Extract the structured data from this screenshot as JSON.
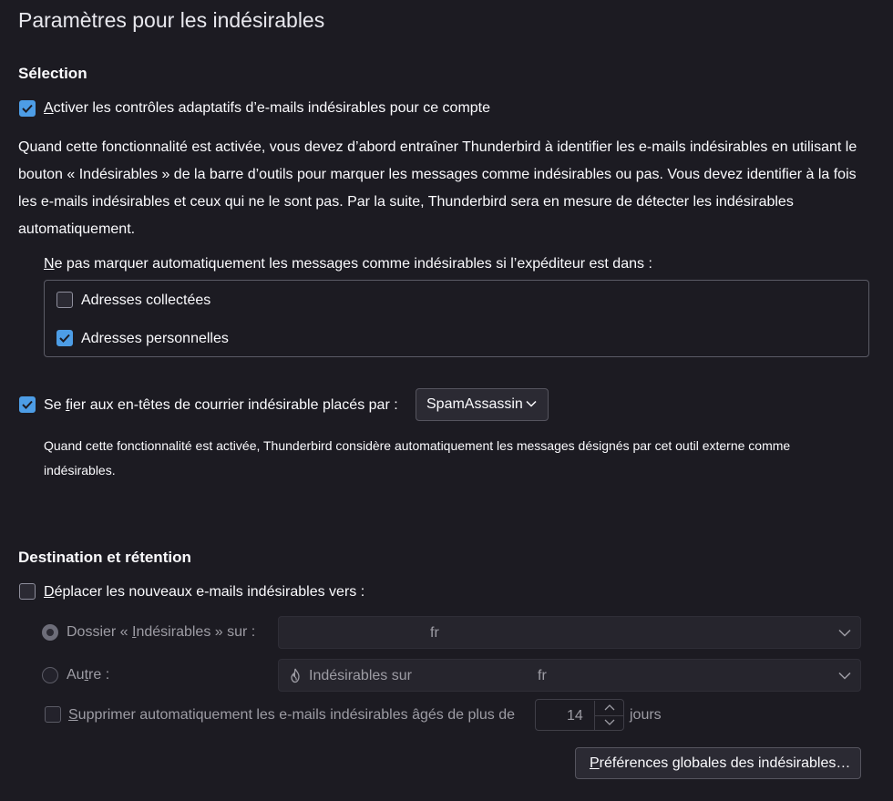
{
  "page": {
    "title": "Paramètres pour les indésirables"
  },
  "selection": {
    "heading": "Sélection",
    "adaptive": {
      "checked": true,
      "label_first": "A",
      "label_rest": "ctiver les contrôles adaptatifs d’e-mails indésirables pour ce compte"
    },
    "description": "Quand cette fonctionnalité est activée, vous devez d’abord entraîner Thunderbird à identifier les e-mails indésirables en utilisant le bouton « Indésirables » de la barre d’outils pour marquer les messages comme indésirables ou pas. Vous devez identifier à la fois les e-mails indésirables et ceux qui ne le sont pas. Par la suite, Thunderbird sera en mesure de détecter les indésirables automatiquement.",
    "whitelist": {
      "label_first": "N",
      "label_rest": "e pas marquer automatiquement les messages comme indésirables si l’expéditeur est dans :",
      "items": [
        {
          "label": "Adresses collectées",
          "checked": false
        },
        {
          "label": "Adresses personnelles",
          "checked": true
        }
      ]
    },
    "trust_headers": {
      "checked": true,
      "label_before": "Se ",
      "label_underlined": "f",
      "label_after": "ier aux en-têtes de courrier indésirable placés par :",
      "selected_value": "SpamAssassin",
      "description": "Quand cette fonctionnalité est activée, Thunderbird considère automatiquement les messages désignés par cet outil externe comme indésirables."
    }
  },
  "destination": {
    "heading": "Destination et rétention",
    "move": {
      "checked": false,
      "label_first": "D",
      "label_rest": "éplacer les nouveaux e-mails indésirables vers :"
    },
    "junk_folder": {
      "selected": true,
      "label_before": "Dossier « ",
      "label_underlined": "I",
      "label_after": "ndésirables » sur :",
      "value": "fr"
    },
    "other": {
      "selected": false,
      "label_before": "Au",
      "label_underlined": "t",
      "label_after": "re :",
      "value_label": "Indésirables sur",
      "value_suffix": "fr",
      "icon": "junk-flame-icon"
    },
    "purge": {
      "checked": false,
      "label_first": "S",
      "label_rest": "upprimer automatiquement les e-mails indésirables âgés de plus de",
      "days": "14",
      "unit": "jours"
    },
    "global_prefs_button": {
      "label_first": "P",
      "label_rest": "références globales des indésirables…"
    }
  },
  "colors": {
    "background": "#1c1b22",
    "accent": "#4d9de6",
    "text": "#fbfbfe",
    "disabled_text": "#9d9ca4"
  }
}
